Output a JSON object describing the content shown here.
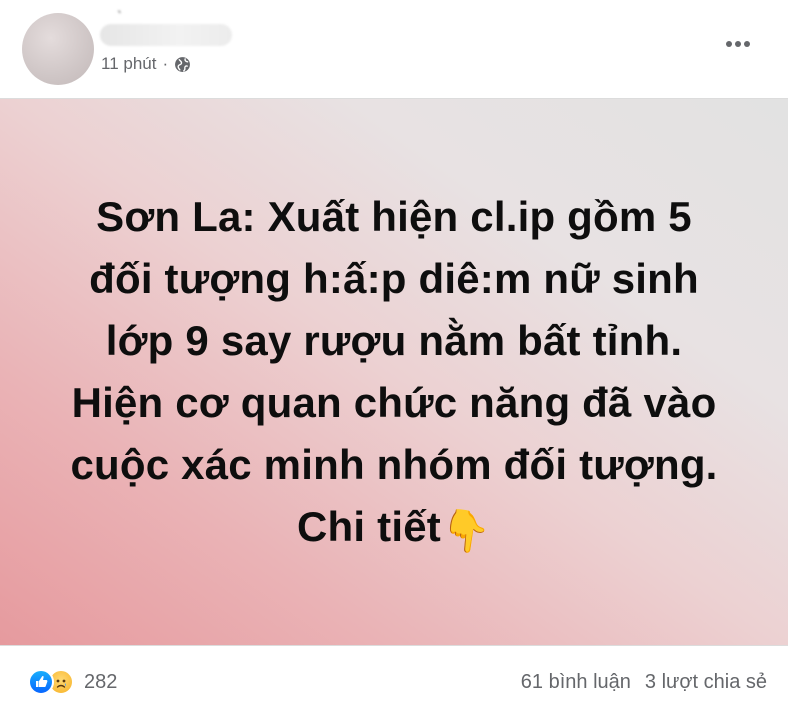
{
  "post": {
    "author_name_visible": "̀",
    "time": "11 phút",
    "separator": "·",
    "audience_icon": "globe-icon",
    "menu_icon": "more-horizontal-icon",
    "text_lines": [
      "Sơn La: Xuất hiện cl.ip gồm 5",
      "đối tượng h:ấ:p diê:m nữ sinh",
      "lớp 9 say rượu nằm bất tỉnh.",
      "Hiện cơ quan chức năng đã vào",
      "cuộc xác minh nhóm đối tượng.",
      "Chi tiết"
    ],
    "emoji_name": "backhand-index-pointing-down-icon",
    "emoji_char": "👇"
  },
  "footer": {
    "reaction_icons": [
      "like-icon",
      "sad-icon"
    ],
    "reaction_count": "282",
    "comments": "61 bình luận",
    "shares": "3 lượt chia sẻ"
  },
  "colors": {
    "meta_text": "#65676b",
    "like_blue": "#0866ff",
    "sad_yellow": "#f7b125"
  }
}
